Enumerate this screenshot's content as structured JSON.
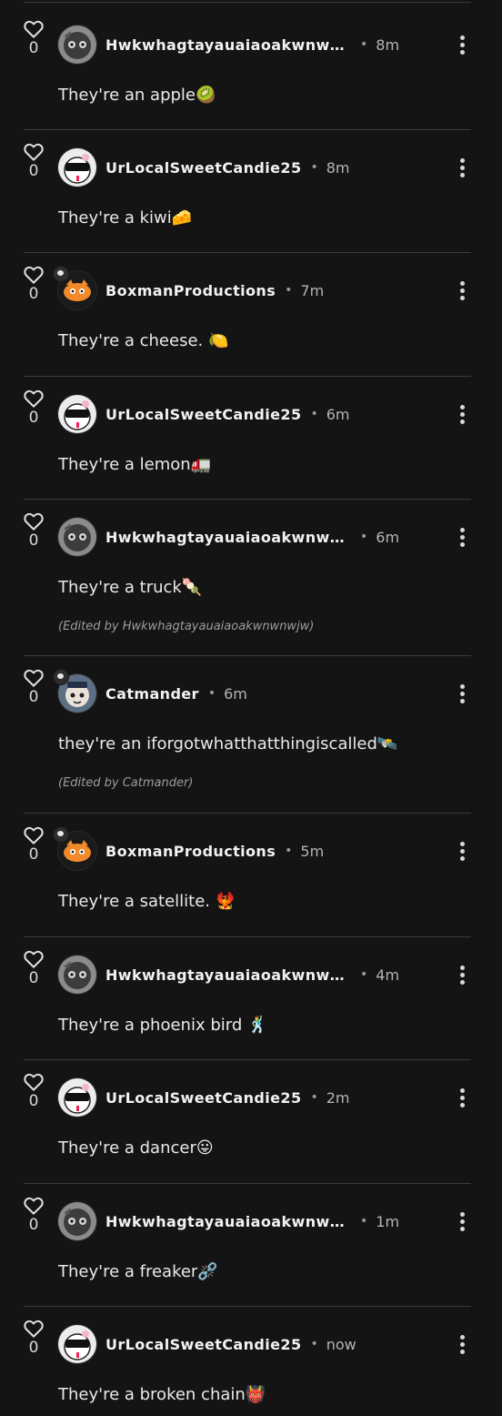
{
  "comments": [
    {
      "likes": "0",
      "username": "Hwkwhagtayauaiaoakwnwn…",
      "time": "8m",
      "text": "They're an apple🥝",
      "edited": ""
    },
    {
      "likes": "0",
      "username": "UrLocalSweetCandie25",
      "time": "8m",
      "text": "They're a kiwi🧀",
      "edited": ""
    },
    {
      "likes": "0",
      "username": "BoxmanProductions",
      "time": "7m",
      "text": "They're a cheese. 🍋",
      "edited": ""
    },
    {
      "likes": "0",
      "username": "UrLocalSweetCandie25",
      "time": "6m",
      "text": "They're a lemon🚛",
      "edited": ""
    },
    {
      "likes": "0",
      "username": "Hwkwhagtayauaiaoakwnwn…",
      "time": "6m",
      "text": "They're a truck🍡",
      "edited": "(Edited by Hwkwhagtayauaiaoakwnwnwjw)"
    },
    {
      "likes": "0",
      "username": "Catmander",
      "time": "6m",
      "text": "they're an iforgotwhatthatthingiscalled🛰️",
      "edited": "(Edited by Catmander)"
    },
    {
      "likes": "0",
      "username": "BoxmanProductions",
      "time": "5m",
      "text": "They're a satellite. 🐦‍🔥",
      "edited": ""
    },
    {
      "likes": "0",
      "username": "Hwkwhagtayauaiaoakwnwn…",
      "time": "4m",
      "text": "They're a phoenix bird 🕺",
      "edited": ""
    },
    {
      "likes": "0",
      "username": "UrLocalSweetCandie25",
      "time": "2m",
      "text": "They're a dancer😛",
      "edited": ""
    },
    {
      "likes": "0",
      "username": "Hwkwhagtayauaiaoakwnwn…",
      "time": "1m",
      "text": "They're a freaker⛓️‍💥",
      "edited": ""
    },
    {
      "likes": "0",
      "username": "UrLocalSweetCandie25",
      "time": "now",
      "text": "They're a broken chain👹",
      "edited": ""
    }
  ],
  "icons": {
    "like": "heart-outline-icon",
    "more": "more-vertical-icon",
    "status": "chat-bubble-icon"
  },
  "colors": {
    "background": "#141414",
    "divider": "#3a3a3a",
    "text": "#eaeaea",
    "muted": "#9d9d9d"
  }
}
